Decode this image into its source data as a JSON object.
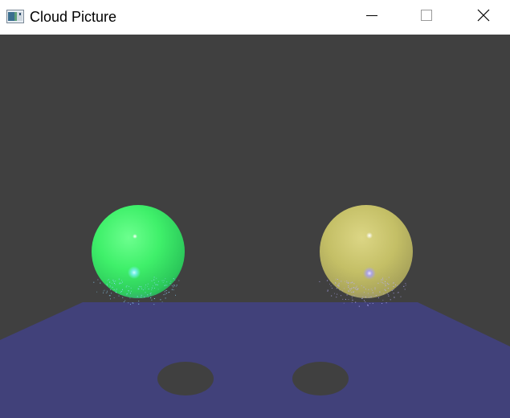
{
  "window": {
    "title": "Cloud Picture",
    "buttons": {
      "minimize": "minimize-icon",
      "maximize": "maximize-icon",
      "close": "close-icon"
    }
  },
  "scene": {
    "background_color": "#404040",
    "floor_color": "#41417a",
    "shadow_color": "#404040",
    "spheres": [
      {
        "name": "green-sphere",
        "color": "#3ff06a"
      },
      {
        "name": "yellow-sphere",
        "color": "#c9c46a"
      }
    ]
  }
}
